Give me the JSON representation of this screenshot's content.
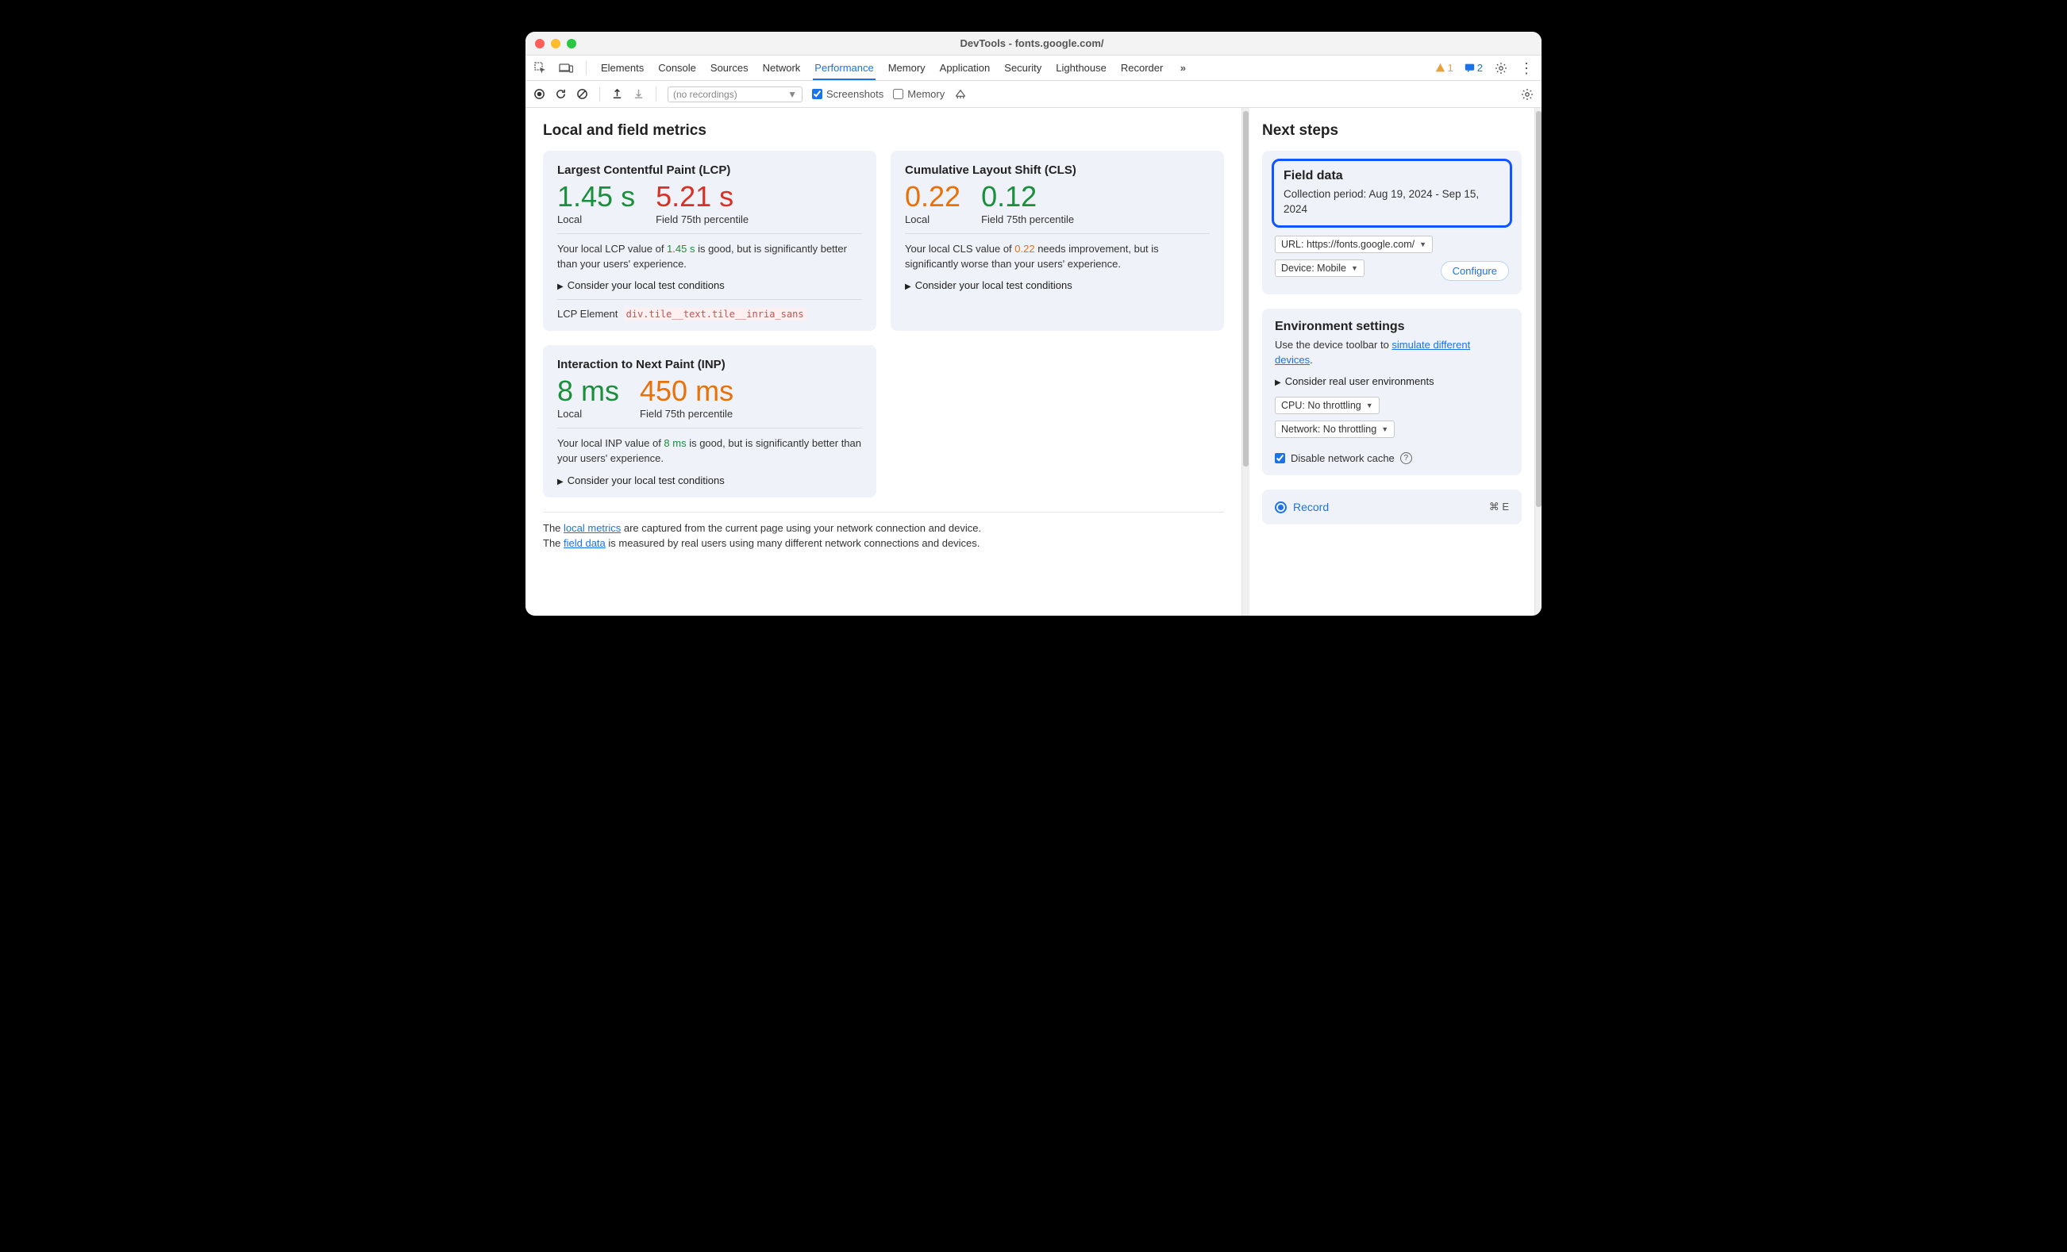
{
  "window_title": "DevTools - fonts.google.com/",
  "tabs": [
    "Elements",
    "Console",
    "Sources",
    "Network",
    "Performance",
    "Memory",
    "Application",
    "Security",
    "Lighthouse",
    "Recorder"
  ],
  "active_tab": "Performance",
  "warn_count": "1",
  "msg_count": "2",
  "toolbar": {
    "recordings_placeholder": "(no recordings)",
    "screenshots_label": "Screenshots",
    "memory_label": "Memory"
  },
  "main_heading": "Local and field metrics",
  "lcp": {
    "title": "Largest Contentful Paint (LCP)",
    "local_value": "1.45 s",
    "local_label": "Local",
    "field_value": "5.21 s",
    "field_label": "Field 75th percentile",
    "desc_pre": "Your local LCP value of ",
    "desc_val": "1.45 s",
    "desc_post": " is good, but is significantly better than your users' experience.",
    "disclose": "Consider your local test conditions",
    "el_label": "LCP Element",
    "el_selector": "div.tile__text.tile__inria_sans"
  },
  "cls": {
    "title": "Cumulative Layout Shift (CLS)",
    "local_value": "0.22",
    "local_label": "Local",
    "field_value": "0.12",
    "field_label": "Field 75th percentile",
    "desc_pre": "Your local CLS value of ",
    "desc_val": "0.22",
    "desc_post": " needs improvement, but is significantly worse than your users' experience.",
    "disclose": "Consider your local test conditions"
  },
  "inp": {
    "title": "Interaction to Next Paint (INP)",
    "local_value": "8 ms",
    "local_label": "Local",
    "field_value": "450 ms",
    "field_label": "Field 75th percentile",
    "desc_pre": "Your local INP value of ",
    "desc_val": "8 ms",
    "desc_post": " is good, but is significantly better than your users' experience.",
    "disclose": "Consider your local test conditions"
  },
  "footnote": {
    "l1a": "The ",
    "l1link": "local metrics",
    "l1b": " are captured from the current page using your network connection and device.",
    "l2a": "The ",
    "l2link": "field data",
    "l2b": " is measured by real users using many different network connections and devices."
  },
  "sidebar": {
    "heading": "Next steps",
    "field_title": "Field data",
    "field_period_label": "Collection period: ",
    "field_period_value": "Aug 19, 2024 - Sep 15, 2024",
    "url_select": "URL: https://fonts.google.com/",
    "device_select": "Device: Mobile",
    "configure": "Configure",
    "env_title": "Environment settings",
    "env_text_pre": "Use the device toolbar to ",
    "env_link": "simulate different devices",
    "env_text_post": ".",
    "env_disclose": "Consider real user environments",
    "cpu_select": "CPU: No throttling",
    "net_select": "Network: No throttling",
    "disable_cache": "Disable network cache",
    "record_label": "Record",
    "record_shortcut": "⌘ E"
  }
}
